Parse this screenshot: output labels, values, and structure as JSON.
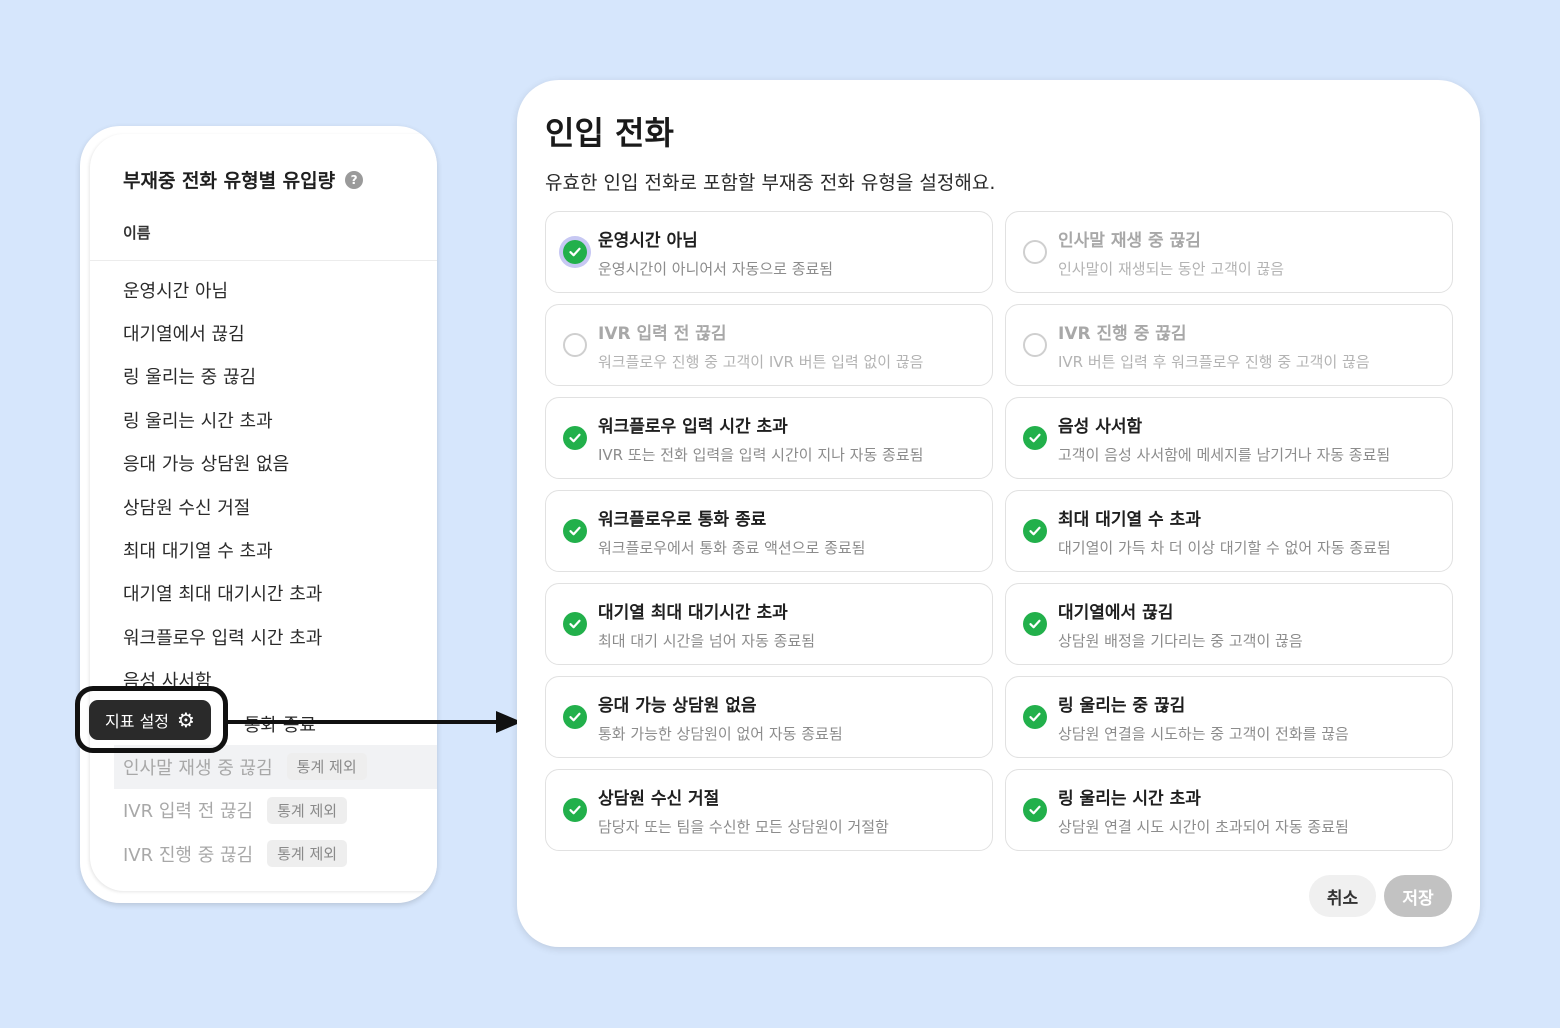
{
  "left_panel": {
    "title": "부재중 전화 유형별 유입량",
    "help_icon": "?",
    "column_header": "이름",
    "items": [
      {
        "label": "운영시간 아님"
      },
      {
        "label": "대기열에서 끊김"
      },
      {
        "label": "링 울리는 중 끊김"
      },
      {
        "label": "링 울리는 시간 초과"
      },
      {
        "label": "응대 가능 상담원 없음"
      },
      {
        "label": "상담원 수신 거절"
      },
      {
        "label": "최대 대기열 수 초과"
      },
      {
        "label": "대기열 최대 대기시간 초과"
      },
      {
        "label": "워크플로우 입력 시간 초과"
      },
      {
        "label": "음성 사서함"
      },
      {
        "label": "통화 종료"
      },
      {
        "label": "인사말 재생 중 끊김",
        "badge": "통계 제외"
      },
      {
        "label": "IVR 입력 전 끊김",
        "badge": "통계 제외"
      },
      {
        "label": "IVR 진행 중 끊김",
        "badge": "통계 제외"
      }
    ]
  },
  "tooltip": {
    "label": "지표 설정",
    "icon": "gear-icon"
  },
  "modal": {
    "title": "인입 전화",
    "subtitle": "유효한 인입 전화로 포함할 부재중 전화 유형을 설정해요.",
    "options": [
      {
        "title": "운영시간 아님",
        "desc": "운영시간이 아니어서 자동으로 종료됨",
        "checked": true
      },
      {
        "title": "인사말 재생 중 끊김",
        "desc": "인사말이 재생되는 동안 고객이 끊음",
        "checked": false
      },
      {
        "title": "IVR 입력 전 끊김",
        "desc": "워크플로우 진행 중 고객이 IVR 버튼 입력 없이 끊음",
        "checked": false
      },
      {
        "title": "IVR 진행 중 끊김",
        "desc": "IVR 버튼 입력 후 워크플로우 진행 중 고객이 끊음",
        "checked": false
      },
      {
        "title": "워크플로우 입력 시간 초과",
        "desc": "IVR 또는 전화 입력을 입력 시간이 지나 자동 종료됨",
        "checked": true
      },
      {
        "title": "음성 사서함",
        "desc": "고객이 음성 사서함에 메세지를 남기거나 자동 종료됨",
        "checked": true
      },
      {
        "title": "워크플로우로 통화 종료",
        "desc": "워크플로우에서 통화 종료 액션으로 종료됨",
        "checked": true
      },
      {
        "title": "최대 대기열 수 초과",
        "desc": "대기열이 가득 차 더 이상 대기할 수 없어 자동 종료됨",
        "checked": true
      },
      {
        "title": "대기열 최대 대기시간 초과",
        "desc": "최대 대기 시간을 넘어 자동 종료됨",
        "checked": true
      },
      {
        "title": "대기열에서 끊김",
        "desc": "상담원 배정을 기다리는 중 고객이 끊음",
        "checked": true
      },
      {
        "title": "응대 가능 상담원 없음",
        "desc": "통화 가능한 상담원이 없어 자동 종료됨",
        "checked": true
      },
      {
        "title": "링 울리는 중 끊김",
        "desc": "상담원 연결을 시도하는 중 고객이 전화를 끊음",
        "checked": true
      },
      {
        "title": "상담원 수신 거절",
        "desc": "담당자 또는 팀을 수신한 모든 상담원이 거절함",
        "checked": true
      },
      {
        "title": "링 울리는 시간 초과",
        "desc": "상담원 연결 시도 시간이 초과되어 자동 종료됨",
        "checked": true
      }
    ],
    "cancel_label": "취소",
    "save_label": "저장"
  },
  "colors": {
    "background": "#d6e6fc",
    "check_green": "#22b04b",
    "focus_ring": "#c7c8f3",
    "save_disabled": "#c2c2c2"
  }
}
